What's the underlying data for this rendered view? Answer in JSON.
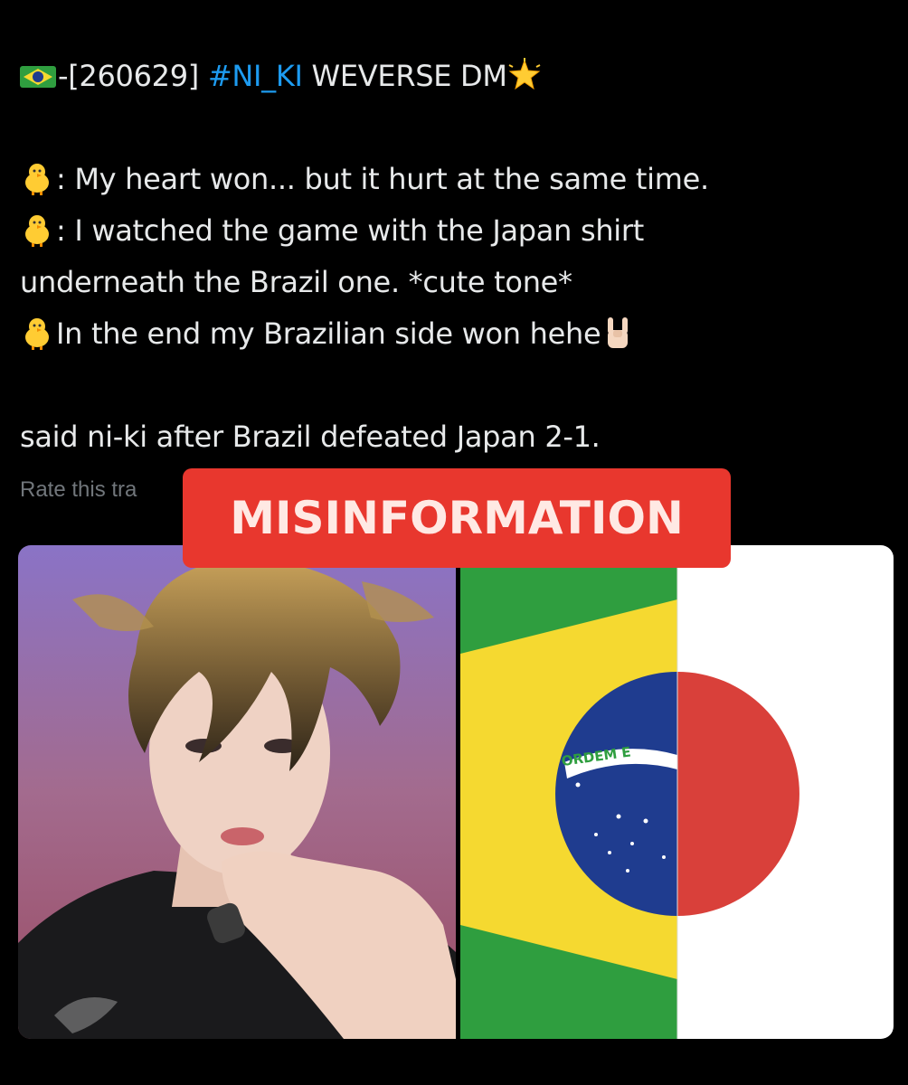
{
  "tweet": {
    "header_prefix": "-[260629] ",
    "hashtag": "#NI_KI",
    "header_suffix": " WEVERSE DM",
    "lines": {
      "line1": ": My heart won... but it hurt at the same time.",
      "line2": ": I watched the game with the Japan shirt",
      "line3": "underneath the Brazil one. *cute tone*",
      "line4": "In the end my Brazilian side won hehe",
      "caption": "said ni-ki after Brazil defeated Japan 2-1."
    },
    "rate_translation": "Rate this tra"
  },
  "overlay": {
    "label": "MISINFORMATION",
    "color": "#e8372e"
  },
  "flag_text": "ORDEM E",
  "colors": {
    "hashtag": "#1d9bf0",
    "text": "#e7e9ea",
    "muted": "#71767b",
    "brazil_green": "#2f9e3f",
    "brazil_yellow": "#f5d930",
    "brazil_blue": "#1f3c8f",
    "japan_red": "#d9403a"
  },
  "icons": [
    "brazil-flag-icon",
    "glowing-star-icon",
    "baby-chick-icon",
    "rock-on-hand-icon"
  ]
}
